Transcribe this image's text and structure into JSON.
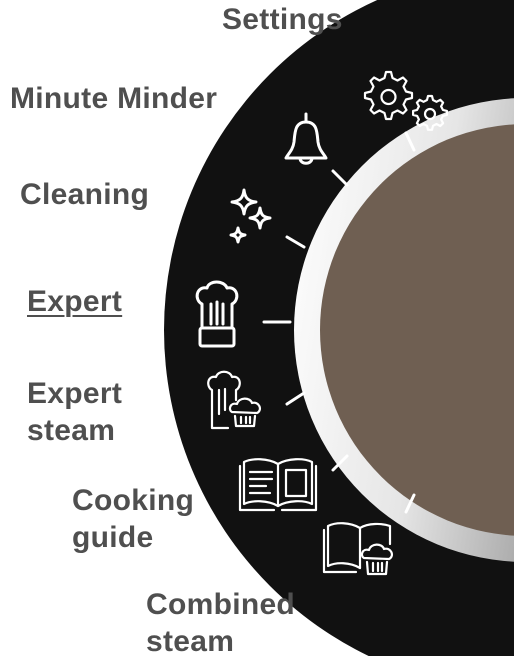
{
  "dial": {
    "colors": {
      "ring": "#111111",
      "knob": "#6f5f52",
      "label": "#4f4f4f",
      "icon": "#ffffff"
    },
    "selected": "expert",
    "modes": [
      {
        "id": "settings",
        "lines": [
          "Settings"
        ],
        "icon": "gears-icon"
      },
      {
        "id": "minute-minder",
        "lines": [
          "Minute Minder"
        ],
        "icon": "bell-icon"
      },
      {
        "id": "cleaning",
        "lines": [
          "Cleaning"
        ],
        "icon": "sparkle-icon"
      },
      {
        "id": "expert",
        "lines": [
          "Expert"
        ],
        "icon": "chef-hat-icon"
      },
      {
        "id": "expert-steam",
        "lines": [
          "Expert",
          "steam"
        ],
        "icon": "chef-hat-steam-icon"
      },
      {
        "id": "cooking-guide",
        "lines": [
          "Cooking",
          "guide"
        ],
        "icon": "open-book-icon"
      },
      {
        "id": "combined-steam",
        "lines": [
          "Combined",
          "steam"
        ],
        "icon": "book-steam-icon"
      }
    ]
  }
}
